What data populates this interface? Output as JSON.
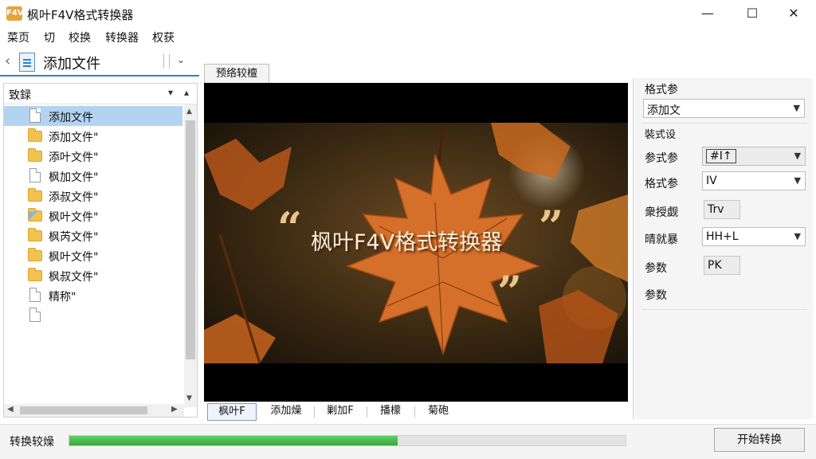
{
  "window": {
    "app_icon_text": "F4V",
    "title": "枫叶F4V格式转换器",
    "minimize": "—",
    "maximize": "☐",
    "close": "✕"
  },
  "menu": [
    "菜页",
    "切",
    "校换",
    "转换器",
    "权获"
  ],
  "nav": {
    "back_icon": "chevron-left-icon",
    "title": "添加文件",
    "dropdown_icon": "chevron-down-icon"
  },
  "left_panel": {
    "title": "致録",
    "collapse_icon": "▾",
    "up_icon": "▴",
    "items": [
      {
        "label": "添加文件",
        "icon": "doc",
        "selected": true
      },
      {
        "label": "添加文件\"",
        "icon": "folder"
      },
      {
        "label": "添叶文件\"",
        "icon": "folder"
      },
      {
        "label": "枫加文件\"",
        "icon": "doc"
      },
      {
        "label": "添叔文件\"",
        "icon": "folder"
      },
      {
        "label": "枫叶文件\"",
        "icon": "folder-blue"
      },
      {
        "label": "枫芮文件\"",
        "icon": "folder"
      },
      {
        "label": "枫叶文件\"",
        "icon": "folder"
      },
      {
        "label": "枫叔文件\"",
        "icon": "folder"
      },
      {
        "label": "精称\"",
        "icon": "doc"
      },
      {
        "label": "",
        "icon": "doc"
      }
    ]
  },
  "preview": {
    "tab_label": "预络较檀",
    "overlay_title": "枫叶F4V格式转换器",
    "quote_open": "“",
    "quote_close": "”",
    "quote_close2": "”"
  },
  "bottom_tabs": [
    "枫叶F",
    "添加燥",
    "剿加F",
    "播檬",
    "菊砲"
  ],
  "right_panel": {
    "section1_label": "格式参",
    "format_combo": "添加文",
    "section2_label": "裝式设",
    "rows": [
      {
        "label": "参式参",
        "value": "#I↑",
        "type": "combo"
      },
      {
        "label": "格式参",
        "value": "IV",
        "type": "combo"
      },
      {
        "label": "衆授觑",
        "value": "Trv",
        "type": "field"
      },
      {
        "label": "晴就暴",
        "value": "HH+L",
        "type": "combo"
      },
      {
        "label": "参数",
        "value": "PK",
        "type": "field"
      },
      {
        "label": "参数",
        "value": "",
        "type": "none"
      }
    ]
  },
  "status": {
    "label": "转换较燥",
    "progress": 0.59,
    "convert_button": "开始转换"
  }
}
